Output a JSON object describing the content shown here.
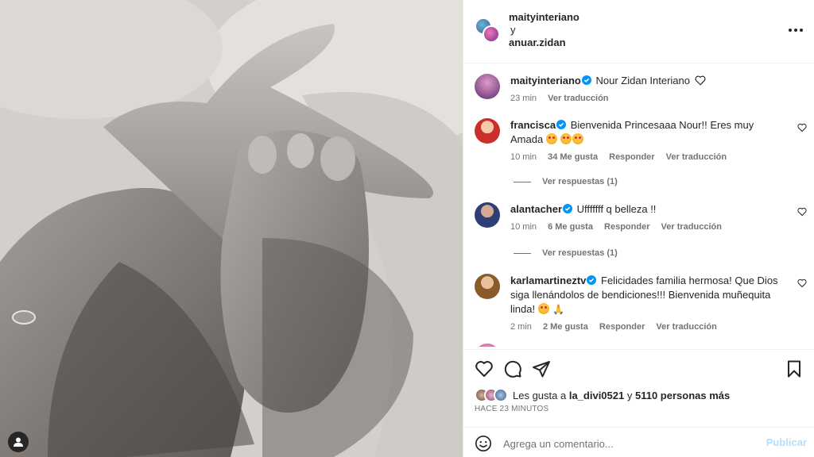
{
  "post": {
    "author": "maityinteriano",
    "connector": "y",
    "coauthor": "anuar.zidan"
  },
  "caption": {
    "user": "maityinteriano",
    "text": "Nour Zidan Interiano",
    "time": "23 min",
    "translate": "Ver traducción"
  },
  "comments": [
    {
      "user": "francisca",
      "text": "Bienvenida Princesaaa Nour!! Eres muy Amada",
      "time": "10 min",
      "likes": "34 Me gusta",
      "reply": "Responder",
      "translate": "Ver traducción",
      "replies": "Ver respuestas (1)"
    },
    {
      "user": "alantacher",
      "text": "Ufffffff q belleza !!",
      "time": "10 min",
      "likes": "6 Me gusta",
      "reply": "Responder",
      "translate": "Ver traducción",
      "replies": "Ver respuestas (1)"
    },
    {
      "user": "karlamartineztv",
      "text": "Felicidades familia hermosa! Que Dios siga llenándolos de bendiciones!!! Bienvenida muñequita linda!",
      "time": "2 min",
      "likes": "2 Me gusta",
      "reply": "Responder",
      "translate": "Ver traducción"
    }
  ],
  "likes_line": {
    "prefix": "Les gusta a",
    "user": "la_divi0521",
    "connector": "y",
    "others": "5110 personas más"
  },
  "posted_ago": "HACE 23 MINUTOS",
  "add_comment": {
    "placeholder": "Agrega un comentario...",
    "post_label": "Publicar"
  },
  "icons": {
    "like": "heart-icon",
    "comment": "comment-icon",
    "share": "share-icon",
    "save": "bookmark-icon",
    "more": "more-icon",
    "emoji": "emoji-icon",
    "verified": "verified-badge-icon"
  },
  "colors": {
    "verified": "#0095f6",
    "meta_text": "#737373",
    "publish_disabled": "#b2dffc"
  }
}
